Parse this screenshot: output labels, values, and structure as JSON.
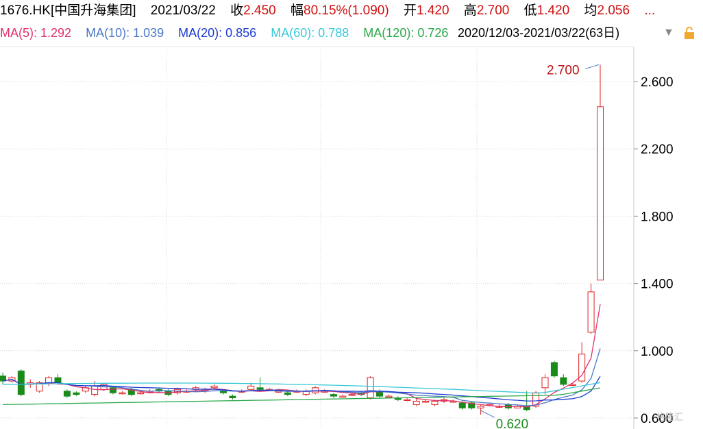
{
  "header": {
    "ticker": "1676.HK[中国升海集团]",
    "date": "2021/03/22",
    "close_label": "收",
    "close": "2.450",
    "change_label": "幅",
    "change": "80.15%(1.090)",
    "open_label": "开",
    "open": "1.420",
    "high_label": "高",
    "high": "2.700",
    "low_label": "低",
    "low": "1.420",
    "avg_label": "均",
    "avg": "2.056",
    "more": "..."
  },
  "ma": [
    {
      "label": "MA(5): 1.292",
      "color": "#e0306a"
    },
    {
      "label": "MA(10): 1.039",
      "color": "#4a78c8"
    },
    {
      "label": "MA(20): 0.856",
      "color": "#1a3ad0"
    },
    {
      "label": "MA(60): 0.788",
      "color": "#38c8d8"
    },
    {
      "label": "MA(120): 0.726",
      "color": "#2aa84a"
    }
  ],
  "range": "2020/12/03-2021/03/22(63日)",
  "watermark": "格隆汇",
  "chart_data": {
    "type": "candlestick",
    "y_ticks": [
      "2.600",
      "2.200",
      "1.800",
      "1.400",
      "1.000",
      "0.600"
    ],
    "ylim": [
      0.6,
      2.75
    ],
    "annotations": {
      "max": "2.700",
      "min": "0.620"
    },
    "colors": {
      "up": "#e02020",
      "down": "#1a8a1a"
    },
    "candles": [
      [
        0.85,
        0.82,
        0.87,
        0.8
      ],
      [
        0.82,
        0.84,
        0.85,
        0.81
      ],
      [
        0.88,
        0.74,
        0.89,
        0.73
      ],
      [
        0.8,
        0.81,
        0.83,
        0.78
      ],
      [
        0.76,
        0.81,
        0.82,
        0.75
      ],
      [
        0.81,
        0.84,
        0.85,
        0.79
      ],
      [
        0.84,
        0.81,
        0.86,
        0.8
      ],
      [
        0.76,
        0.73,
        0.77,
        0.72
      ],
      [
        0.75,
        0.74,
        0.76,
        0.73
      ],
      [
        0.76,
        0.78,
        0.79,
        0.75
      ],
      [
        0.74,
        0.79,
        0.82,
        0.73
      ],
      [
        0.77,
        0.8,
        0.81,
        0.76
      ],
      [
        0.78,
        0.75,
        0.79,
        0.74
      ],
      [
        0.75,
        0.75,
        0.76,
        0.74
      ],
      [
        0.77,
        0.74,
        0.78,
        0.73
      ],
      [
        0.75,
        0.75,
        0.76,
        0.74
      ],
      [
        0.76,
        0.76,
        0.77,
        0.75
      ],
      [
        0.77,
        0.76,
        0.78,
        0.75
      ],
      [
        0.76,
        0.74,
        0.77,
        0.73
      ],
      [
        0.75,
        0.77,
        0.78,
        0.74
      ],
      [
        0.76,
        0.76,
        0.77,
        0.75
      ],
      [
        0.77,
        0.78,
        0.79,
        0.76
      ],
      [
        0.76,
        0.77,
        0.78,
        0.75
      ],
      [
        0.78,
        0.79,
        0.8,
        0.77
      ],
      [
        0.76,
        0.75,
        0.77,
        0.74
      ],
      [
        0.73,
        0.72,
        0.74,
        0.71
      ],
      [
        0.76,
        0.76,
        0.77,
        0.75
      ],
      [
        0.77,
        0.79,
        0.81,
        0.76
      ],
      [
        0.78,
        0.77,
        0.84,
        0.76
      ],
      [
        0.77,
        0.77,
        0.78,
        0.76
      ],
      [
        0.76,
        0.76,
        0.77,
        0.75
      ],
      [
        0.75,
        0.74,
        0.76,
        0.73
      ],
      [
        0.76,
        0.76,
        0.77,
        0.75
      ],
      [
        0.74,
        0.76,
        0.77,
        0.73
      ],
      [
        0.75,
        0.78,
        0.79,
        0.74
      ],
      [
        0.76,
        0.76,
        0.77,
        0.75
      ],
      [
        0.74,
        0.73,
        0.75,
        0.72
      ],
      [
        0.73,
        0.73,
        0.74,
        0.72
      ],
      [
        0.74,
        0.74,
        0.75,
        0.73
      ],
      [
        0.75,
        0.74,
        0.76,
        0.73
      ],
      [
        0.72,
        0.84,
        0.85,
        0.71
      ],
      [
        0.76,
        0.73,
        0.77,
        0.72
      ],
      [
        0.73,
        0.73,
        0.74,
        0.72
      ],
      [
        0.72,
        0.71,
        0.73,
        0.7
      ],
      [
        0.71,
        0.71,
        0.72,
        0.7
      ],
      [
        0.68,
        0.7,
        0.72,
        0.67
      ],
      [
        0.7,
        0.7,
        0.71,
        0.69
      ],
      [
        0.68,
        0.7,
        0.71,
        0.67
      ],
      [
        0.7,
        0.71,
        0.72,
        0.69
      ],
      [
        0.7,
        0.7,
        0.71,
        0.69
      ],
      [
        0.69,
        0.66,
        0.7,
        0.65
      ],
      [
        0.69,
        0.66,
        0.7,
        0.65
      ],
      [
        0.66,
        0.67,
        0.68,
        0.62
      ],
      [
        0.68,
        0.68,
        0.69,
        0.67
      ],
      [
        0.67,
        0.67,
        0.68,
        0.66
      ],
      [
        0.68,
        0.66,
        0.69,
        0.65
      ],
      [
        0.66,
        0.67,
        0.68,
        0.66
      ],
      [
        0.67,
        0.65,
        0.76,
        0.64
      ],
      [
        0.67,
        0.75,
        0.76,
        0.66
      ],
      [
        0.78,
        0.84,
        0.86,
        0.74
      ],
      [
        0.93,
        0.85,
        0.94,
        0.84
      ],
      [
        0.84,
        0.8,
        0.86,
        0.79
      ],
      [
        0.8,
        0.8,
        0.81,
        0.79
      ],
      [
        0.82,
        0.98,
        1.05,
        0.81
      ],
      [
        1.11,
        1.35,
        1.4,
        1.1
      ],
      [
        1.42,
        2.45,
        2.7,
        1.42
      ]
    ]
  }
}
